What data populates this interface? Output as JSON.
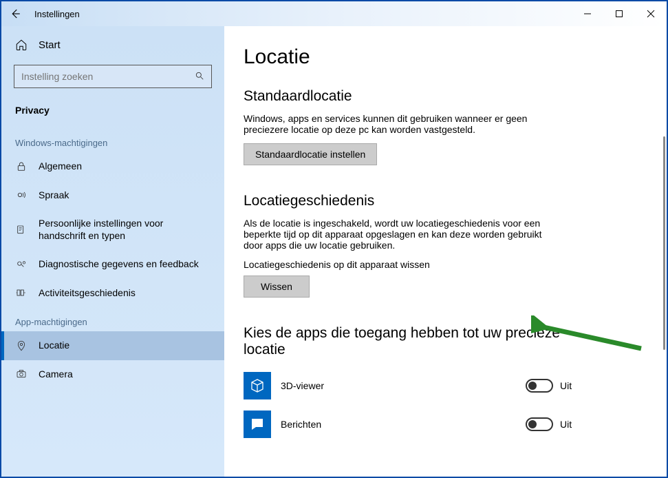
{
  "titlebar": {
    "title": "Instellingen"
  },
  "sidebar": {
    "home": "Start",
    "search_placeholder": "Instelling zoeken",
    "category": "Privacy",
    "section_windows": "Windows-machtigingen",
    "items_windows": [
      {
        "label": "Algemeen"
      },
      {
        "label": "Spraak"
      },
      {
        "label": "Persoonlijke instellingen voor handschrift en typen"
      },
      {
        "label": "Diagnostische gegevens en feedback"
      },
      {
        "label": "Activiteitsgeschiedenis"
      }
    ],
    "section_app": "App-machtigingen",
    "items_app": [
      {
        "label": "Locatie",
        "active": true
      },
      {
        "label": "Camera"
      }
    ]
  },
  "main": {
    "page_title": "Locatie",
    "default_location": {
      "heading": "Standaardlocatie",
      "description": "Windows, apps en services kunnen dit gebruiken wanneer er geen preciezere locatie op deze pc kan worden vastgesteld.",
      "button": "Standaardlocatie instellen"
    },
    "history": {
      "heading": "Locatiegeschiedenis",
      "description": "Als de locatie is ingeschakeld, wordt uw locatiegeschiedenis voor een beperkte tijd op dit apparaat opgeslagen en kan deze worden gebruikt door apps die uw locatie gebruiken.",
      "clear_label": "Locatiegeschiedenis op dit apparaat wissen",
      "clear_button": "Wissen"
    },
    "apps": {
      "heading": "Kies de apps die toegang hebben tot uw precieze locatie",
      "list": [
        {
          "name": "3D-viewer",
          "state": "Uit"
        },
        {
          "name": "Berichten",
          "state": "Uit"
        }
      ]
    }
  }
}
